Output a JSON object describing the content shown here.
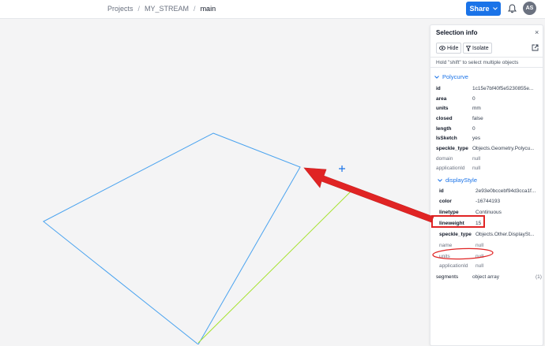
{
  "breadcrumb": {
    "items": [
      "Projects",
      "MY_STREAM",
      "main"
    ],
    "separator": "/"
  },
  "toolbar": {
    "share_label": "Share",
    "avatar_initials": "AS"
  },
  "panel": {
    "title": "Selection info",
    "hide_label": "Hide",
    "isolate_label": "Isolate",
    "hint": "Hold \"shift\" to select multiple objects",
    "polycurve": {
      "header": "Polycurve",
      "rows": [
        {
          "key": "id",
          "value": "1c15e7bf40f5e5230855e..."
        },
        {
          "key": "area",
          "value": "0"
        },
        {
          "key": "units",
          "value": "mm"
        },
        {
          "key": "closed",
          "value": "false"
        },
        {
          "key": "length",
          "value": "0"
        },
        {
          "key": "IsSketch",
          "value": "yes"
        },
        {
          "key": "speckle_type",
          "value": "Objects.Geometry.Polycu..."
        },
        {
          "key": "domain",
          "value": "null"
        },
        {
          "key": "applicationId",
          "value": "null"
        }
      ]
    },
    "displayStyle": {
      "header": "displayStyle",
      "rows": [
        {
          "key": "id",
          "value": "2e93e0bccebf94d3cca1f..."
        },
        {
          "key": "color",
          "value": "-16744193"
        },
        {
          "key": "linetype",
          "value": "Continuous"
        },
        {
          "key": "lineweight",
          "value": "15"
        },
        {
          "key": "speckle_type",
          "value": "Objects.Other.DisplaySt..."
        },
        {
          "key": "name",
          "value": "null"
        },
        {
          "key": "units",
          "value": "null"
        },
        {
          "key": "applicationId",
          "value": "null"
        }
      ]
    },
    "segments": {
      "key": "segments",
      "value": "object array",
      "count": "(1)"
    }
  },
  "colors": {
    "accent": "#1a73e8",
    "polycurve_line": "#4aa3ef",
    "segment_line": "#a6e22e",
    "annotation": "#e02424"
  }
}
